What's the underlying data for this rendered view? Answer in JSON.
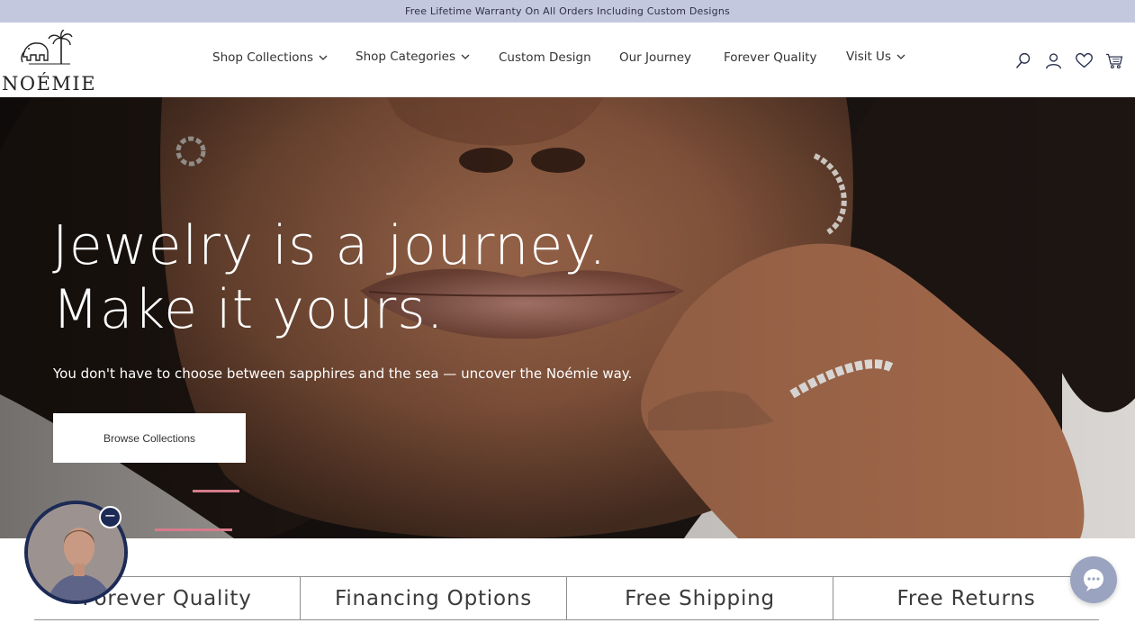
{
  "announcement": "Free Lifetime Warranty On All Orders Including Custom Designs",
  "brand": {
    "name": "NOÉMIE",
    "logo_icon": "elephant-palm-icon"
  },
  "nav": {
    "items": [
      {
        "label": "Shop Collections",
        "dropdown": true
      },
      {
        "label": "Shop Categories",
        "dropdown": true
      },
      {
        "label": "Custom Design",
        "dropdown": false
      },
      {
        "label": "Our Journey",
        "dropdown": false
      },
      {
        "label": "Forever Quality",
        "dropdown": false
      },
      {
        "label": "Visit Us",
        "dropdown": true
      }
    ]
  },
  "header_icons": [
    "search-icon",
    "account-icon",
    "wishlist-heart-icon",
    "cart-icon"
  ],
  "hero": {
    "title_line1": "Jewelry is a journey.",
    "title_line2": "Make it yours.",
    "subtitle": "You don't have to choose between sapphires and the sea — uncover the Noémie way.",
    "button_label": "Browse Collections"
  },
  "features": [
    "Forever Quality",
    "Financing Options",
    "Free Shipping",
    "Free Returns"
  ],
  "widgets": {
    "video_bubble_close": "−",
    "chat_icon": "chat-bubble-icon"
  },
  "colors": {
    "announcement_bg": "#c3c8df",
    "accent_navy": "#1c2a55",
    "dash_pink": "#d67b8b",
    "chat_bg": "#9aa3bf"
  }
}
